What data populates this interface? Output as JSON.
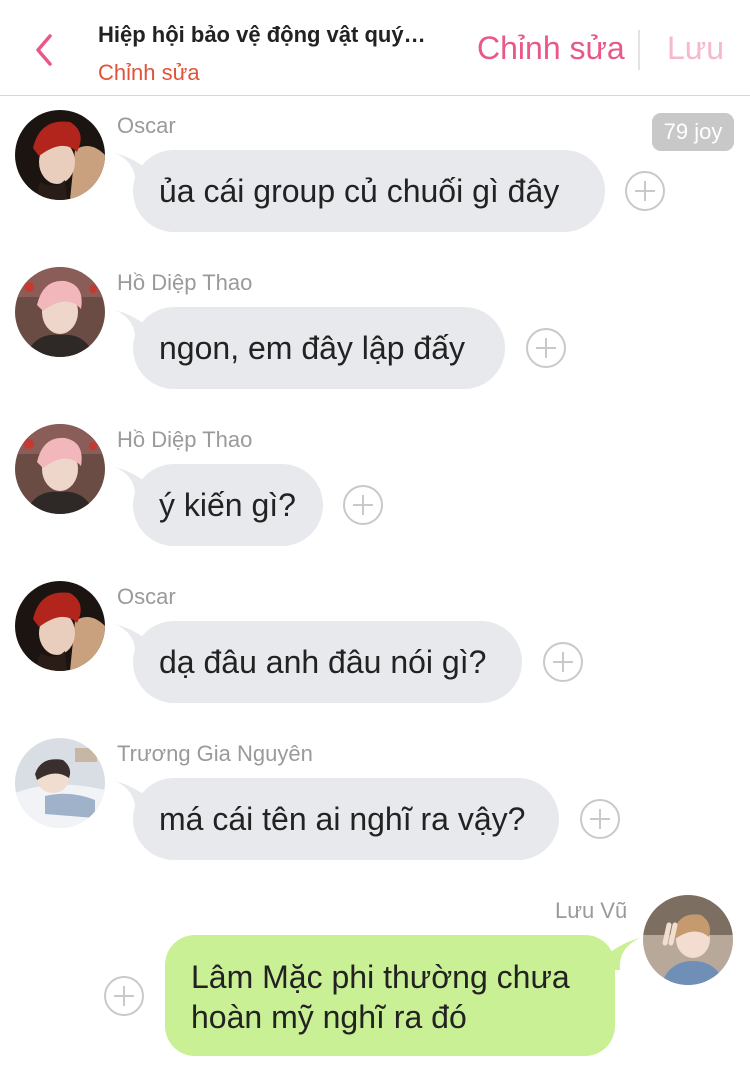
{
  "header": {
    "title": "Hiệp hội bảo vệ động vật quý…",
    "subtitle": "Chỉnh sửa",
    "edit_label": "Chỉnh sửa",
    "save_label": "Lưu"
  },
  "messages": [
    {
      "sender": "Oscar",
      "text": "ủa cái group củ chuối gì đây",
      "badge": "79 joy"
    },
    {
      "sender": "Hồ Diệp Thao",
      "text": "ngon, em đây lập đấy"
    },
    {
      "sender": "Hồ Diệp Thao",
      "text": "ý kiến gì?"
    },
    {
      "sender": "Oscar",
      "text": "dạ đâu anh đâu nói gì?"
    },
    {
      "sender": "Trương Gia Nguyên",
      "text": "má cái tên ai nghĩ ra vậy?"
    },
    {
      "sender": "Lưu Vũ",
      "text": "Lâm Mặc phi thường chưa\nhoàn mỹ nghĩ ra đó"
    }
  ],
  "colors": {
    "accent": "#e8588a",
    "accent_light": "#f6b8cc",
    "subtitle": "#e0533a",
    "incoming_bubble": "#e7e9ed",
    "outgoing_bubble": "#c9f094"
  },
  "icons": [
    "back-chevron-icon",
    "add-reaction-icon"
  ]
}
